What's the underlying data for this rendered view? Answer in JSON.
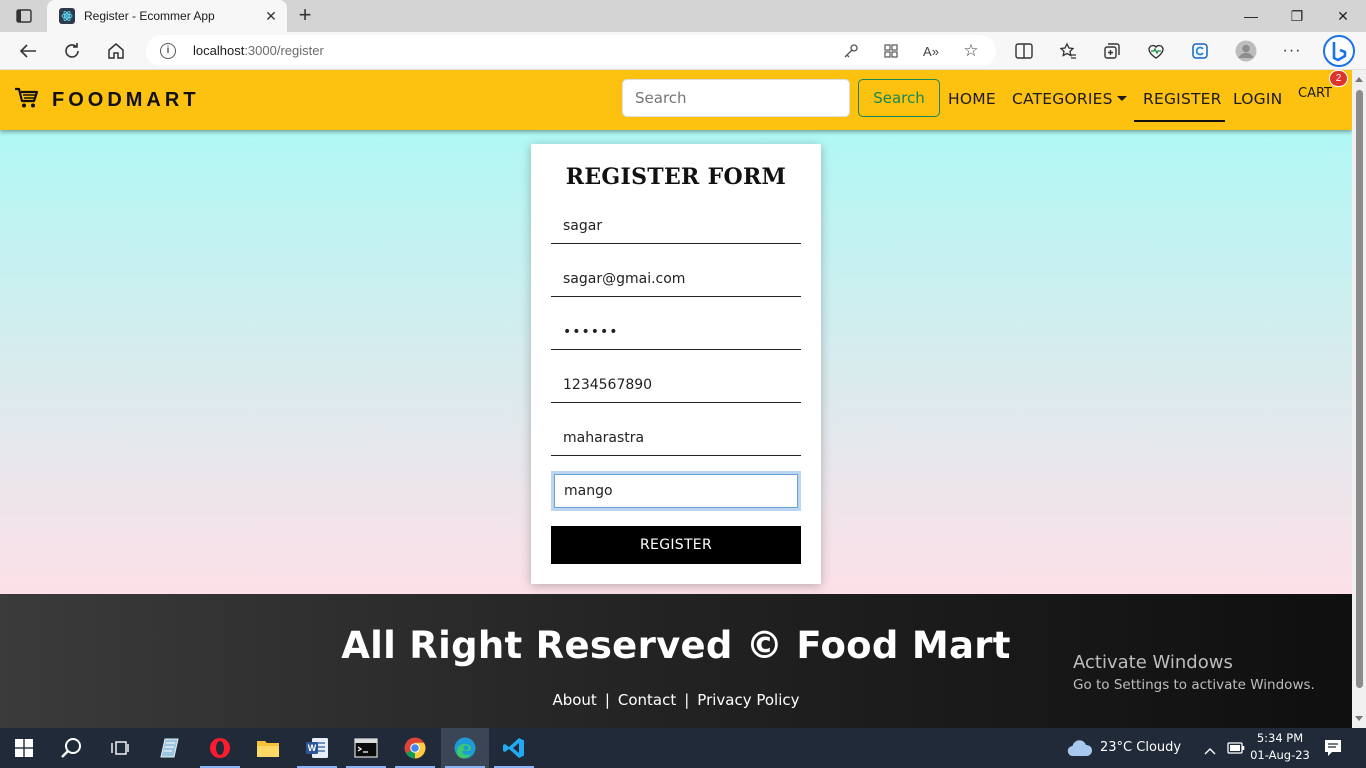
{
  "browser": {
    "tab_title": "Register - Ecommer App",
    "url_host": "localhost",
    "url_rest": ":3000/register"
  },
  "navbar": {
    "brand": "FOODMART",
    "search_placeholder": "Search",
    "search_button": "Search",
    "links": {
      "home": "HOME",
      "categories": "CATEGORIES",
      "register": "REGISTER",
      "login": "LOGIN",
      "cart": "CART"
    },
    "cart_count": "2",
    "active_link": "register"
  },
  "form": {
    "title": "REGISTER FORM",
    "name": "sagar",
    "email": "sagar@gmai.com",
    "password": "••••••",
    "phone": "1234567890",
    "address": "maharastra",
    "answer": "mango",
    "submit": "REGISTER"
  },
  "footer": {
    "title": "All Right Reserved © Food Mart",
    "about": "About",
    "contact": "Contact",
    "privacy": "Privacy Policy",
    "sep": "|"
  },
  "watermark": {
    "line1": "Activate Windows",
    "line2": "Go to Settings to activate Windows."
  },
  "taskbar": {
    "weather": "23°C  Cloudy",
    "time": "5:34 PM",
    "date": "01-Aug-23"
  },
  "colors": {
    "navbar": "#fdc10f",
    "search_button": "#198754",
    "badge": "#e0322d"
  }
}
